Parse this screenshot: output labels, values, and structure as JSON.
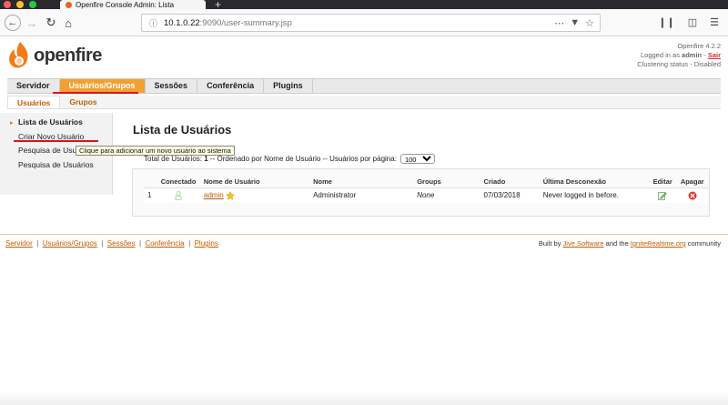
{
  "browser": {
    "tab_title": "Openfire Console Admin: Lista",
    "url_host": "10.1.0.22",
    "url_path": ":9090/user-summary.jsp"
  },
  "header": {
    "logo_text": "openfire",
    "version": "Openfire 4.2.2",
    "logged_prefix": "Logged in as ",
    "user": "admin",
    "separator": " - ",
    "logout": "Sair",
    "clustering": "Clustering status - Disabled"
  },
  "mainnav": {
    "items": [
      "Servidor",
      "Usuários/Grupos",
      "Sessões",
      "Conferência",
      "Plugins"
    ]
  },
  "subnav": {
    "items": [
      "Usuários",
      "Grupos"
    ]
  },
  "sidebar": {
    "items": [
      "Lista de Usuários",
      "Criar Novo Usuário",
      "Pesquisa de Usuár",
      "Pesquisa de Usuários"
    ],
    "tooltip": "Clique para adicionar um novo usuário ao sistema"
  },
  "content": {
    "title": "Lista de Usuários",
    "summary_prefix": "Total de Usuários: ",
    "total": "1",
    "summary_suffix": " -- Ordenado por Nome de Usuário -- Usuários por página:",
    "per_page": "100"
  },
  "table": {
    "headers": [
      "",
      "Conectado",
      "Nome de Usuário",
      "Nome",
      "Groups",
      "Criado",
      "Última Desconexão",
      "Editar",
      "Apagar"
    ],
    "rows": [
      {
        "num": "1",
        "username": "admin",
        "name": "Administrator",
        "groups": "None",
        "created": "07/03/2018",
        "last": "Never logged in before."
      }
    ]
  },
  "footer": {
    "links": [
      "Servidor",
      "Usuários/Grupos",
      "Sessões",
      "Conferência",
      "Plugins"
    ],
    "sep": "|",
    "built_prefix": "Built by ",
    "built_link1": "Jive Software",
    "built_mid": " and the ",
    "built_link2": "IgniteRealtime.org",
    "built_suffix": " community"
  },
  "colors": {
    "accent": "#f0a133",
    "link": "#c55b00",
    "highlight_underline": "#e0111b"
  }
}
